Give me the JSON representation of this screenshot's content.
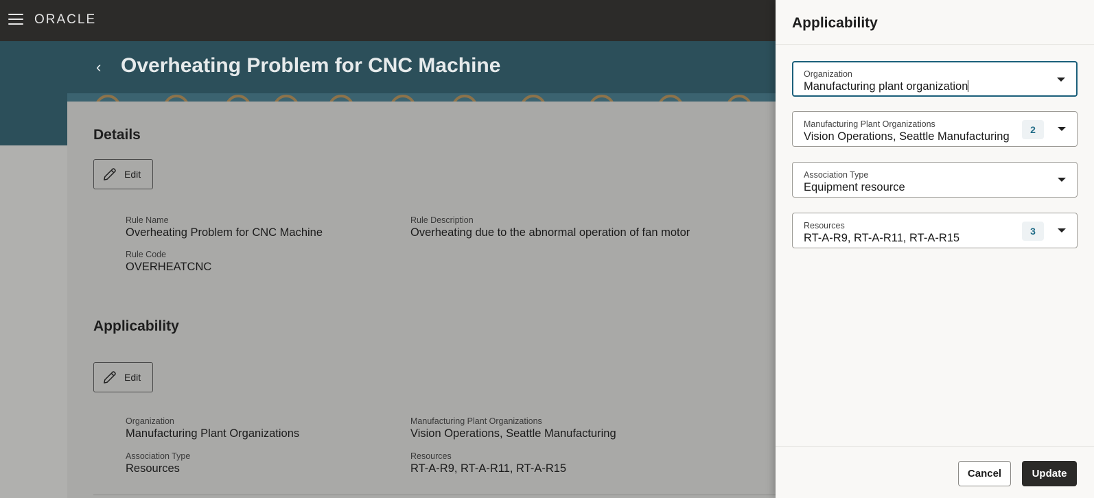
{
  "topbar": {
    "logo": "ORACLE"
  },
  "header": {
    "title": "Overheating Problem for CNC Machine"
  },
  "details": {
    "title": "Details",
    "edit_label": "Edit",
    "rule_name_label": "Rule Name",
    "rule_name": "Overheating Problem for CNC Machine",
    "rule_description_label": "Rule Description",
    "rule_description": "Overheating due to the abnormal operation of fan motor",
    "rule_code_label": "Rule Code",
    "rule_code": "OVERHEATCNC"
  },
  "applicability": {
    "title": "Applicability",
    "edit_label": "Edit",
    "organization_label": "Organization",
    "organization": "Manufacturing Plant Organizations",
    "plant_orgs_label": "Manufacturing Plant Organizations",
    "plant_orgs": "Vision Operations, Seattle Manufacturing",
    "association_type_label": "Association Type",
    "association_type": "Resources",
    "resources_label": "Resources",
    "resources": "RT-A-R9, RT-A-R11, RT-A-R15"
  },
  "drawer": {
    "title": "Applicability",
    "organization_label": "Organization",
    "organization_value": "Manufacturing plant organization",
    "plant_orgs_label": "Manufacturing Plant Organizations",
    "plant_orgs_value": "Vision Operations, Seattle Manufacturing",
    "plant_orgs_count": "2",
    "association_type_label": "Association Type",
    "association_type_value": "Equipment resource",
    "resources_label": "Resources",
    "resources_value": "RT-A-R9, RT-A-R11, RT-A-R15",
    "resources_count": "3",
    "cancel_label": "Cancel",
    "update_label": "Update"
  },
  "colors": {
    "topbar": "#2c2b29",
    "hero": "#2c4f5a",
    "focus_border": "#1b5f7a",
    "primary_button": "#2b2a28"
  }
}
